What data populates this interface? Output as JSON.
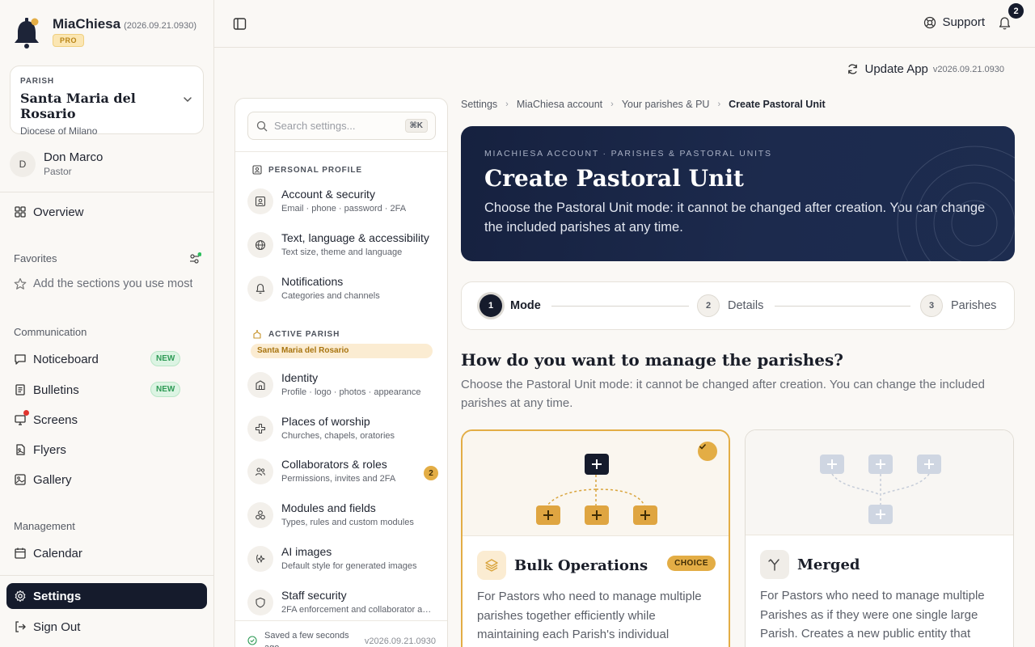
{
  "app": {
    "name": "MiaChiesa",
    "version": "(2026.09.21.0930)",
    "plan": "PRO"
  },
  "parish": {
    "label": "PARISH",
    "name": "Santa Maria del Rosario",
    "diocese": "Diocese of Milano"
  },
  "user": {
    "initial": "D",
    "name": "Don Marco",
    "role": "Pastor"
  },
  "nav": {
    "overview": "Overview",
    "favorites_label": "Favorites",
    "favorites_hint": "Add the sections you use most",
    "communication_label": "Communication",
    "noticeboard": "Noticeboard",
    "bulletins": "Bulletins",
    "new_badge": "NEW",
    "screens": "Screens",
    "flyers": "Flyers",
    "gallery": "Gallery",
    "management_label": "Management",
    "calendar": "Calendar",
    "settings": "Settings",
    "sign_out": "Sign Out"
  },
  "topbar": {
    "support": "Support",
    "notifications_count": "2",
    "update_app": "Update App",
    "update_version": "v2026.09.21.0930"
  },
  "settings_panel": {
    "search_placeholder": "Search settings...",
    "shortcut": "⌘K",
    "personal_section": "PERSONAL PROFILE",
    "active_section": "ACTIVE PARISH",
    "active_parish": "Santa Maria del Rosario",
    "items": [
      {
        "title": "Account & security",
        "sub": "Email · phone · password · 2FA"
      },
      {
        "title": "Text, language & accessibility",
        "sub": "Text size, theme and language"
      },
      {
        "title": "Notifications",
        "sub": "Categories and channels"
      },
      {
        "title": "Identity",
        "sub": "Profile · logo · photos · appearance"
      },
      {
        "title": "Places of worship",
        "sub": "Churches, chapels, oratories"
      },
      {
        "title": "Collaborators & roles",
        "sub": "Permissions, invites and 2FA",
        "count": "2"
      },
      {
        "title": "Modules and fields",
        "sub": "Types, rules and custom modules"
      },
      {
        "title": "AI images",
        "sub": "Default style for generated images"
      },
      {
        "title": "Staff security",
        "sub": "2FA enforcement and collaborator access"
      }
    ],
    "saved": "Saved a few seconds ago",
    "version": "v2026.09.21.0930"
  },
  "breadcrumb": [
    "Settings",
    "MiaChiesa account",
    "Your parishes & PU",
    "Create Pastoral Unit"
  ],
  "hero": {
    "kicker": "MIACHIESA ACCOUNT · PARISHES & PASTORAL UNITS",
    "title": "Create Pastoral Unit",
    "desc": "Choose the Pastoral Unit mode: it cannot be changed after creation. You can change the included parishes at any time."
  },
  "stepper": [
    {
      "num": "1",
      "label": "Mode"
    },
    {
      "num": "2",
      "label": "Details"
    },
    {
      "num": "3",
      "label": "Parishes"
    }
  ],
  "question": {
    "title": "How do you want to manage the parishes?",
    "desc": "Choose the Pastoral Unit mode: it cannot be changed after creation. You can change the included parishes at any time."
  },
  "cards": [
    {
      "title": "Bulk Operations",
      "badge": "CHOICE",
      "desc": "For Pastors who need to manage multiple parishes together efficiently while maintaining each Parish's individual"
    },
    {
      "title": "Merged",
      "desc": "For Pastors who need to manage multiple Parishes as if they were one single large Parish. Creates a new public entity that"
    }
  ],
  "colors": {
    "accent": "#e3ad45",
    "navy": "#151b2c",
    "new_green": "#2e9a55"
  }
}
